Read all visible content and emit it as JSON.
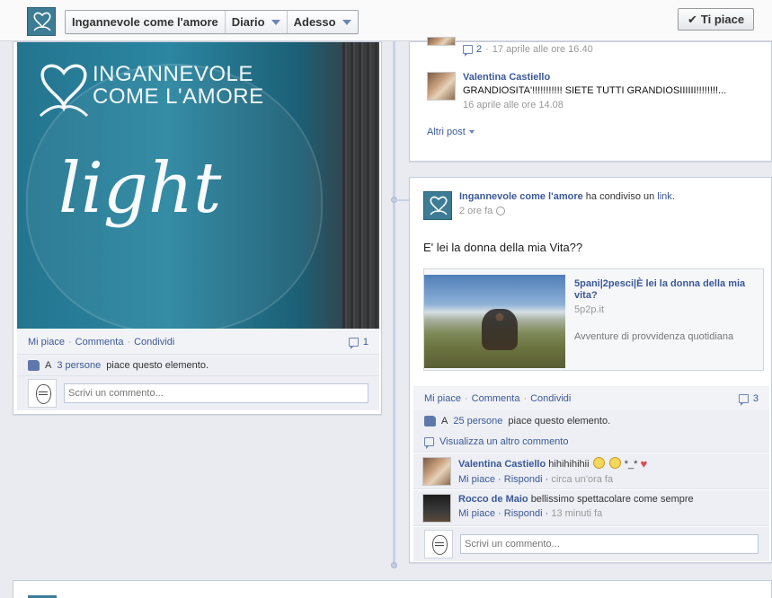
{
  "header": {
    "page_name": "Ingannevole come l'amore",
    "timeline_label": "Diario",
    "date_label": "Adesso",
    "like_button": "Ti piace"
  },
  "left_post": {
    "photo_text_line1": "INGANNEVOLE",
    "photo_text_line2": "COME L'AMORE",
    "photo_script": "light",
    "actions": {
      "like": "Mi piace",
      "comment": "Commenta",
      "share": "Condividi"
    },
    "comment_count": "1",
    "likes_prefix": "A",
    "likes_people": "3 persone",
    "likes_suffix": "piace questo elemento.",
    "comment_placeholder": "Scrivi un commento..."
  },
  "right_top": {
    "first_item": {
      "comment_count": "2",
      "time": "17 aprile alle ore 16.40"
    },
    "second_item": {
      "name": "Valentina Castiello",
      "text": "GRANDIOSITA'!!!!!!!!!!! SIETE TUTTI GRANDIOSIIIIII!!!!!!!!...",
      "time": "16 aprile alle ore 14.08"
    },
    "more_posts": "Altri post"
  },
  "right_post": {
    "author": "Ingannevole come l'amore",
    "shared_prefix": "ha condiviso un",
    "shared_link": "link",
    "time": "2 ore fa",
    "message": "E' lei la donna della mia Vita??",
    "link_preview": {
      "title": "5pani|2pesci|È lei la donna della mia vita?",
      "domain": "5p2p.it",
      "description": "Avventure di provvidenza quotidiana"
    },
    "actions": {
      "like": "Mi piace",
      "comment": "Commenta",
      "share": "Condividi"
    },
    "comment_count": "3",
    "likes_prefix": "A",
    "likes_people": "25 persone",
    "likes_suffix": "piace questo elemento.",
    "view_more": "Visualizza un altro commento",
    "comments": [
      {
        "name": "Valentina Castiello",
        "text": "hihihihihii",
        "extra": "*_*",
        "like": "Mi piace",
        "reply": "Rispondi",
        "time": "circa un'ora fa"
      },
      {
        "name": "Rocco de Maio",
        "text": "bellissimo spettacolare come sempre",
        "like": "Mi piace",
        "reply": "Rispondi",
        "time": "13 minuti fa"
      }
    ],
    "comment_placeholder": "Scrivi un commento..."
  },
  "colors": {
    "link": "#3b5998",
    "brand_teal": "#3c7c95",
    "background": "#e9ebf1"
  }
}
